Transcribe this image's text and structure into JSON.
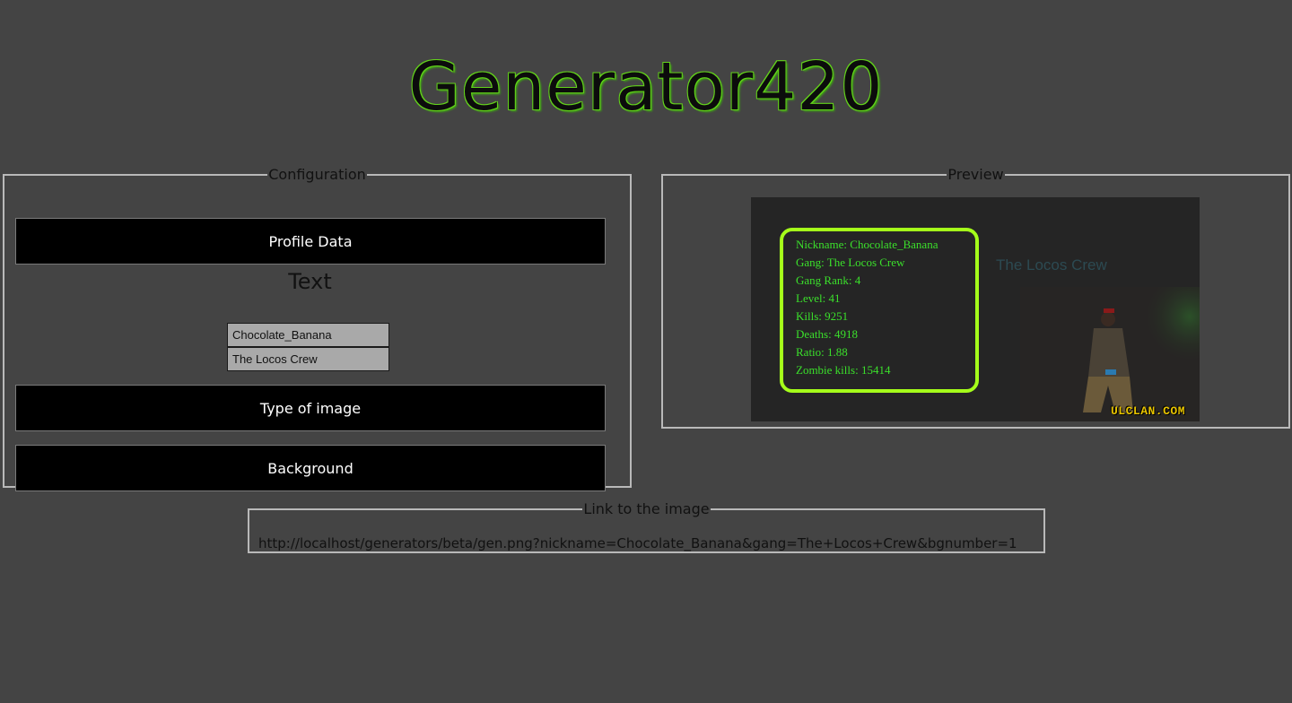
{
  "header": {
    "title": "Generator420"
  },
  "configuration": {
    "legend": "Configuration",
    "sections": {
      "profile_data": "Profile Data",
      "text_heading": "Text",
      "type_of_image": "Type of image",
      "background": "Background"
    },
    "fields": {
      "nickname_value": "Chocolate_Banana",
      "gang_value": "The Locos Crew"
    }
  },
  "preview": {
    "legend": "Preview",
    "stats": [
      "Nickname: Chocolate_Banana",
      "Gang: The Locos Crew",
      "Gang Rank: 4",
      "Level: 41",
      "Kills: 9251",
      "Deaths: 4918",
      "Ratio: 1.88",
      "Zombie kills: 15414"
    ],
    "gang_overlay": "The Locos Crew",
    "brand": "ULCLAN.COM",
    "colors": {
      "frame": "#a5ff1a",
      "stat_text": "#3be02b",
      "brand": "#e8c400"
    }
  },
  "link": {
    "legend": "Link to the image",
    "url": "http://localhost/generators/beta/gen.png?nickname=Chocolate_Banana&gang=The+Locos+Crew&bgnumber=1"
  }
}
